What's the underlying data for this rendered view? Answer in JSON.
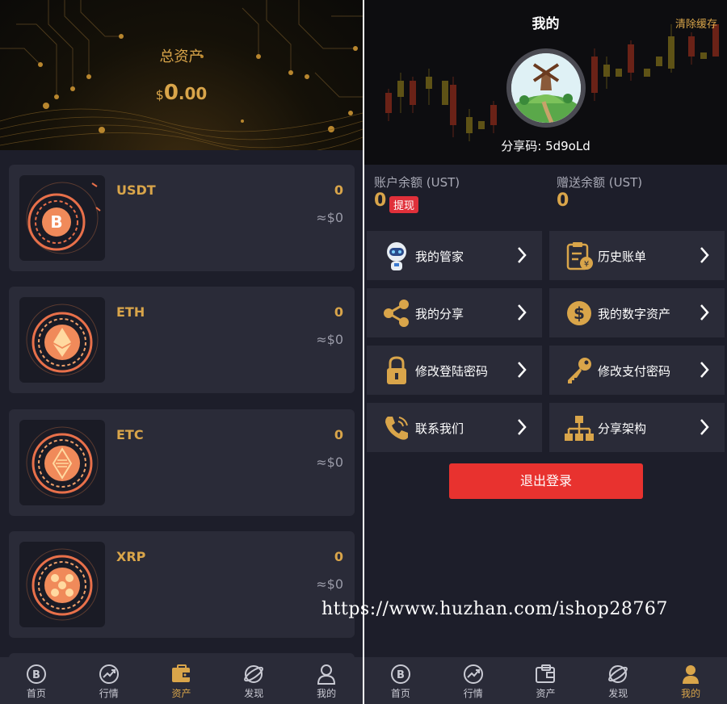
{
  "left": {
    "header": {
      "title": "总资产",
      "currency": "$",
      "amount_int": "0",
      "amount_dec": ".00"
    },
    "coins": [
      {
        "name": "USDT",
        "quantity": "0",
        "usd_value": "≈$0",
        "icon": "bitcoin-coin-icon"
      },
      {
        "name": "ETH",
        "quantity": "0",
        "usd_value": "≈$0",
        "icon": "ethereum-coin-icon"
      },
      {
        "name": "ETC",
        "quantity": "0",
        "usd_value": "≈$0",
        "icon": "ethereum-classic-coin-icon"
      },
      {
        "name": "XRP",
        "quantity": "0",
        "usd_value": "≈$0",
        "icon": "ripple-coin-icon"
      }
    ],
    "tabbar": [
      {
        "label": "首页",
        "icon": "bitcoin-icon",
        "active": false
      },
      {
        "label": "行情",
        "icon": "trend-chart-icon",
        "active": false
      },
      {
        "label": "资产",
        "icon": "wallet-icon",
        "active": true
      },
      {
        "label": "发现",
        "icon": "planet-icon",
        "active": false
      },
      {
        "label": "我的",
        "icon": "user-icon",
        "active": false
      }
    ]
  },
  "right": {
    "header": {
      "title": "我的",
      "clear_cache": "清除缓存",
      "share_code": "分享码: 5d9oLd"
    },
    "balances": {
      "account_label": "账户余额 (UST)",
      "account_value": "0",
      "withdraw_label": "提现",
      "gift_label": "赠送余额 (UST)",
      "gift_value": "0"
    },
    "menu": [
      {
        "label": "我的管家",
        "icon": "robot-icon"
      },
      {
        "label": "历史账单",
        "icon": "bill-icon"
      },
      {
        "label": "我的分享",
        "icon": "share-icon"
      },
      {
        "label": "我的数字资产",
        "icon": "dollar-icon"
      },
      {
        "label": "修改登陆密码",
        "icon": "lock-icon"
      },
      {
        "label": "修改支付密码",
        "icon": "key-icon"
      },
      {
        "label": "联系我们",
        "icon": "phone-icon"
      },
      {
        "label": "分享架构",
        "icon": "org-chart-icon"
      }
    ],
    "logout_label": "退出登录",
    "tabbar": [
      {
        "label": "首页",
        "icon": "bitcoin-icon",
        "active": false
      },
      {
        "label": "行情",
        "icon": "trend-chart-icon",
        "active": false
      },
      {
        "label": "资产",
        "icon": "wallet-icon",
        "active": false
      },
      {
        "label": "发现",
        "icon": "planet-icon",
        "active": false
      },
      {
        "label": "我的",
        "icon": "user-icon",
        "active": true
      }
    ]
  },
  "watermark": "https://www.huzhan.com/ishop28767",
  "colors": {
    "accent": "#d9a54a",
    "card": "#2a2b38",
    "background": "#1d1e2a",
    "danger": "#e8322f"
  }
}
